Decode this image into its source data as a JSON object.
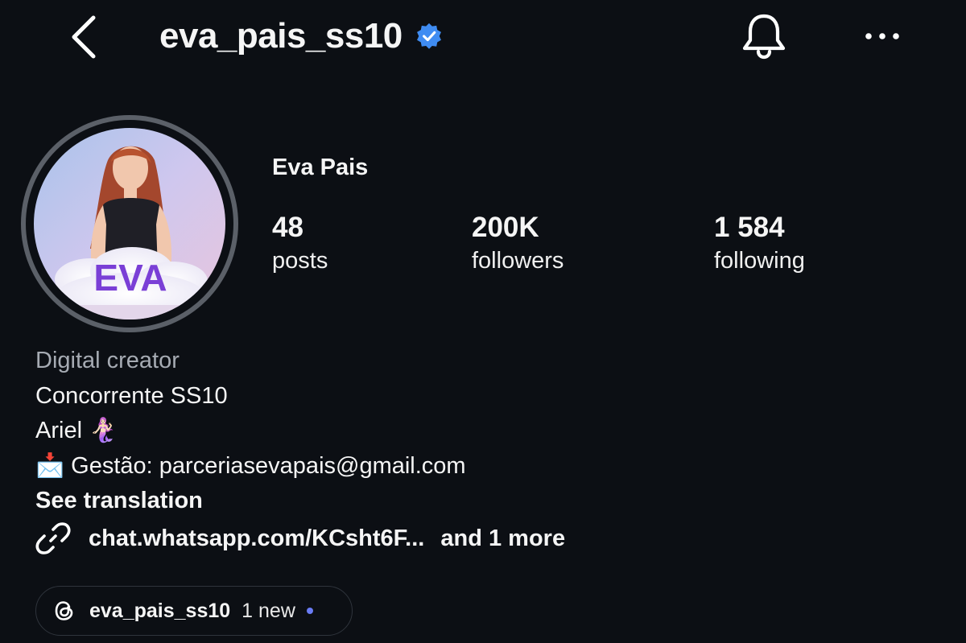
{
  "header": {
    "username": "eva_pais_ss10",
    "verified": true,
    "icons": [
      "chevron-left-icon",
      "verified-badge-icon",
      "bell-icon",
      "more-horizontal-icon"
    ]
  },
  "profile": {
    "display_name": "Eva Pais",
    "avatar_text": "EVA",
    "stats": [
      {
        "value": "48",
        "label": "posts"
      },
      {
        "value": "200K",
        "label": "followers"
      },
      {
        "value": "1 584",
        "label": "following"
      }
    ]
  },
  "bio": {
    "category": "Digital creator",
    "lines": [
      "Concorrente SS10",
      "Ariel 🧜🏻‍♀️",
      "📩 Gestão: parceriasevapais@gmail.com"
    ],
    "see_translation": "See translation"
  },
  "link": {
    "icon": "link-icon",
    "text": "chat.whatsapp.com/KCsht6F...",
    "more": "and 1 more"
  },
  "threads": {
    "icon": "threads-icon",
    "username": "eva_pais_ss10",
    "new_label": "1 new"
  },
  "colors": {
    "background": "#0c0f14",
    "verified": "#3f8cf2",
    "muted": "#a6abb3",
    "dot": "#6a7cf5",
    "avatar_ring": "#5b6068",
    "avatar_text": "#7a3fd6"
  }
}
